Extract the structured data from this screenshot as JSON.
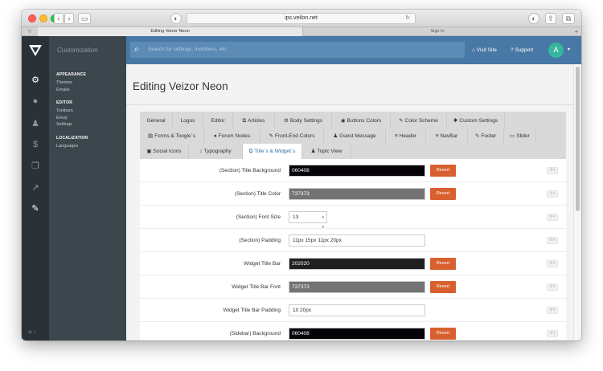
{
  "browser": {
    "url": "ips.veilon.net",
    "tabs": [
      {
        "label": "Editing Veizor Neon"
      },
      {
        "label": "Sign In"
      }
    ]
  },
  "sidebar": {
    "header": "Customization",
    "sections": [
      {
        "title": "APPEARANCE",
        "items": [
          "Themes",
          "Emails"
        ]
      },
      {
        "title": "EDITOR",
        "items": [
          "Toolbars",
          "Emoji",
          "Settings"
        ]
      },
      {
        "title": "LOCALIZATION",
        "items": [
          "Languages"
        ]
      }
    ]
  },
  "topbar": {
    "search_placeholder": "Search for settings, members, etc.",
    "visit_site": "Visit Site",
    "support": "Support",
    "avatar_letter": "A"
  },
  "page": {
    "title": "Editing Veizor Neon"
  },
  "tabs": [
    {
      "label": "General"
    },
    {
      "label": "Logos"
    },
    {
      "label": "Editor"
    },
    {
      "label": "Articles"
    },
    {
      "label": "Body Settings"
    },
    {
      "label": "Buttons Colors"
    },
    {
      "label": "Color Scheme"
    },
    {
      "label": "Custom Settings"
    },
    {
      "label": "Forms & Toogle`s"
    },
    {
      "label": "Forum Nodes"
    },
    {
      "label": "Front-End Colors"
    },
    {
      "label": "Guest Message"
    },
    {
      "label": "Header"
    },
    {
      "label": "NavBar"
    },
    {
      "label": "Footer"
    },
    {
      "label": "Slider"
    },
    {
      "label": "Social Icons"
    },
    {
      "label": "Typography"
    },
    {
      "label": "Title`s & Widget`s"
    },
    {
      "label": "Topic View"
    }
  ],
  "active_tab": "Title`s & Widget`s",
  "settings": [
    {
      "label": "(Section) Title Background",
      "value": "060408",
      "revert": "Revert",
      "swatch_color": "#060408"
    },
    {
      "label": "(Section) Title Color",
      "value": "737373",
      "revert": "Revert",
      "swatch_color": "#737373"
    },
    {
      "label": "(Section) Font Size",
      "value": "13"
    },
    {
      "label": "(Section) Padding",
      "value": "11px 15px 11px 20px"
    },
    {
      "label": "Widget Title Bar",
      "value": "202020",
      "revert": "Revert",
      "swatch_color": "#202020"
    },
    {
      "label": "Widget Title Bar Font",
      "value": "737373",
      "revert": "Revert",
      "swatch_color": "#737373"
    },
    {
      "label": "Widget Title Bar Padding",
      "value": "10 20px"
    },
    {
      "label": "(Sidebar) Background",
      "value": "060408",
      "revert": "Revert",
      "swatch_color": "#060408"
    }
  ],
  "colors": {
    "accent": "#4878a6",
    "revert": "#d8602f",
    "sidebar": "#3b464d",
    "rail": "#2b3237"
  }
}
